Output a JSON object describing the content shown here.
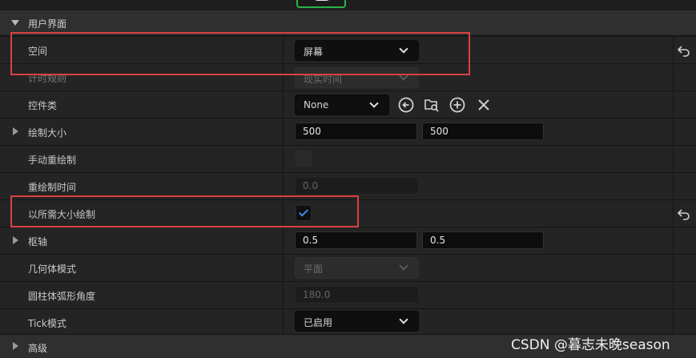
{
  "section": {
    "title": "用户界面"
  },
  "rows": {
    "space": {
      "label": "空间",
      "value": "屏幕"
    },
    "timing_policy": {
      "label": "计时规则",
      "value": "现实时间"
    },
    "widget_class": {
      "label": "控件类",
      "value": "None"
    },
    "draw_size": {
      "label": "绘制大小",
      "x": "500",
      "y": "500"
    },
    "manual_redraw": {
      "label": "手动重绘制",
      "checked": false
    },
    "redraw_time": {
      "label": "重绘制时间",
      "value": "0.0"
    },
    "draw_at_desired_size": {
      "label": "以所需大小绘制",
      "checked": true
    },
    "pivot": {
      "label": "枢轴",
      "x": "0.5",
      "y": "0.5"
    },
    "geometry_mode": {
      "label": "几何体模式",
      "value": "平面"
    },
    "cylinder_arc_angle": {
      "label": "圆柱体弧形角度",
      "value": "180.0"
    },
    "tick_mode": {
      "label": "Tick模式",
      "value": "已启用"
    }
  },
  "advanced": {
    "title": "高级"
  },
  "watermark": "CSDN @暮志未晚season",
  "colors": {
    "highlight": "#d94141",
    "checkmark": "#3a8ee8",
    "thumbnail_border": "#2bb34b"
  },
  "icons": {
    "reset": "reset-to-default-icon",
    "use_selected": "arrow-left-circle-icon",
    "browse": "browse-folder-icon",
    "add": "plus-circle-icon",
    "clear": "x-icon"
  }
}
